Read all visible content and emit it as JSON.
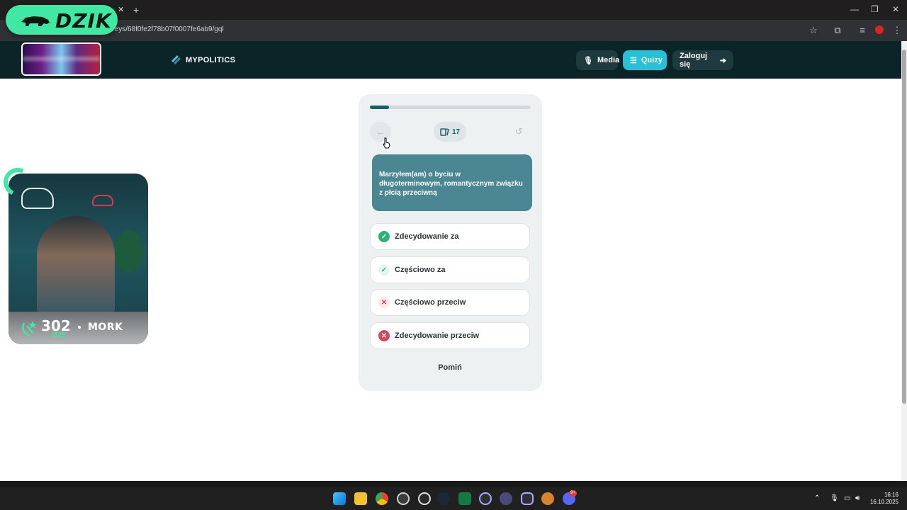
{
  "browser": {
    "url": "/surveys/68f0fe2f78b07f0007fe6ab9/gql",
    "new_tab": "+",
    "tab_close": "✕",
    "window_controls": [
      "—",
      "❐",
      "✕"
    ]
  },
  "overlay": {
    "logo_text": "DZIK"
  },
  "site": {
    "brand": "MYPOLITICS",
    "nav": {
      "media": "Media",
      "quizy": "Quizy",
      "login": "Zaloguj się"
    }
  },
  "quiz": {
    "progress": 0.12,
    "card_count": "17",
    "question": "Marzyłem(am) o byciu w długoterminowym, romantycznym związku z płcią przeciwną",
    "answers": [
      {
        "label": "Zdecydowanie za",
        "icon": "check-circle-icon"
      },
      {
        "label": "Częściowo za",
        "icon": "check-icon"
      },
      {
        "label": "Częściowo przeciw",
        "icon": "x-icon"
      },
      {
        "label": "Zdecydowanie przeciw",
        "icon": "x-circle-icon"
      }
    ],
    "skip": "Pomiń"
  },
  "webcam": {
    "score": "302",
    "of": "/325",
    "name": "MORK"
  },
  "taskbar": {
    "time": "16:16",
    "date": "16.10.2025",
    "discord_badge": "9+"
  },
  "colors": {
    "accent_green": "#3fe9a4",
    "header_bg": "#0b2428",
    "quizy_active": "#25c1d6",
    "question_bg": "#4b8792",
    "progress": "#14606b"
  }
}
